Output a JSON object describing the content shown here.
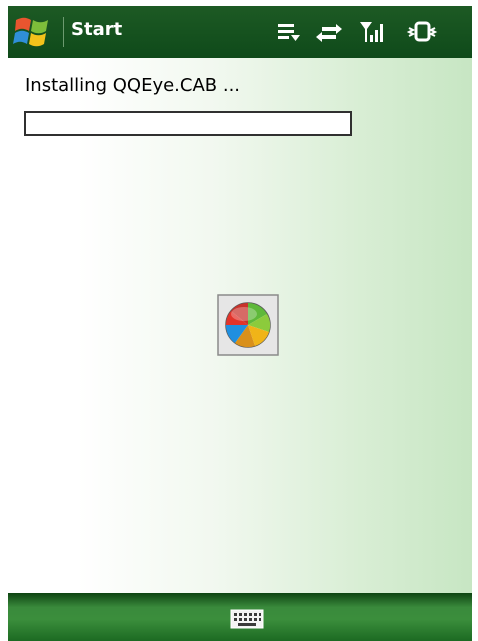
{
  "titlebar": {
    "title": "Start",
    "icons": [
      "windows-start-icon",
      "notification-list-icon",
      "connectivity-icon",
      "signal-strength-icon",
      "vibrate-icon"
    ]
  },
  "install": {
    "status": "Installing QQEye.CAB ...",
    "progress": 0
  },
  "busy_icon": "busy-wheel-icon",
  "bottombar": {
    "icons": [
      "keyboard-icon"
    ]
  },
  "colors": {
    "titlebar": "#1d5a24",
    "bottombar": "#3b8e3c",
    "content_gradient_end": "#c7e6c3",
    "text": "#000000"
  }
}
